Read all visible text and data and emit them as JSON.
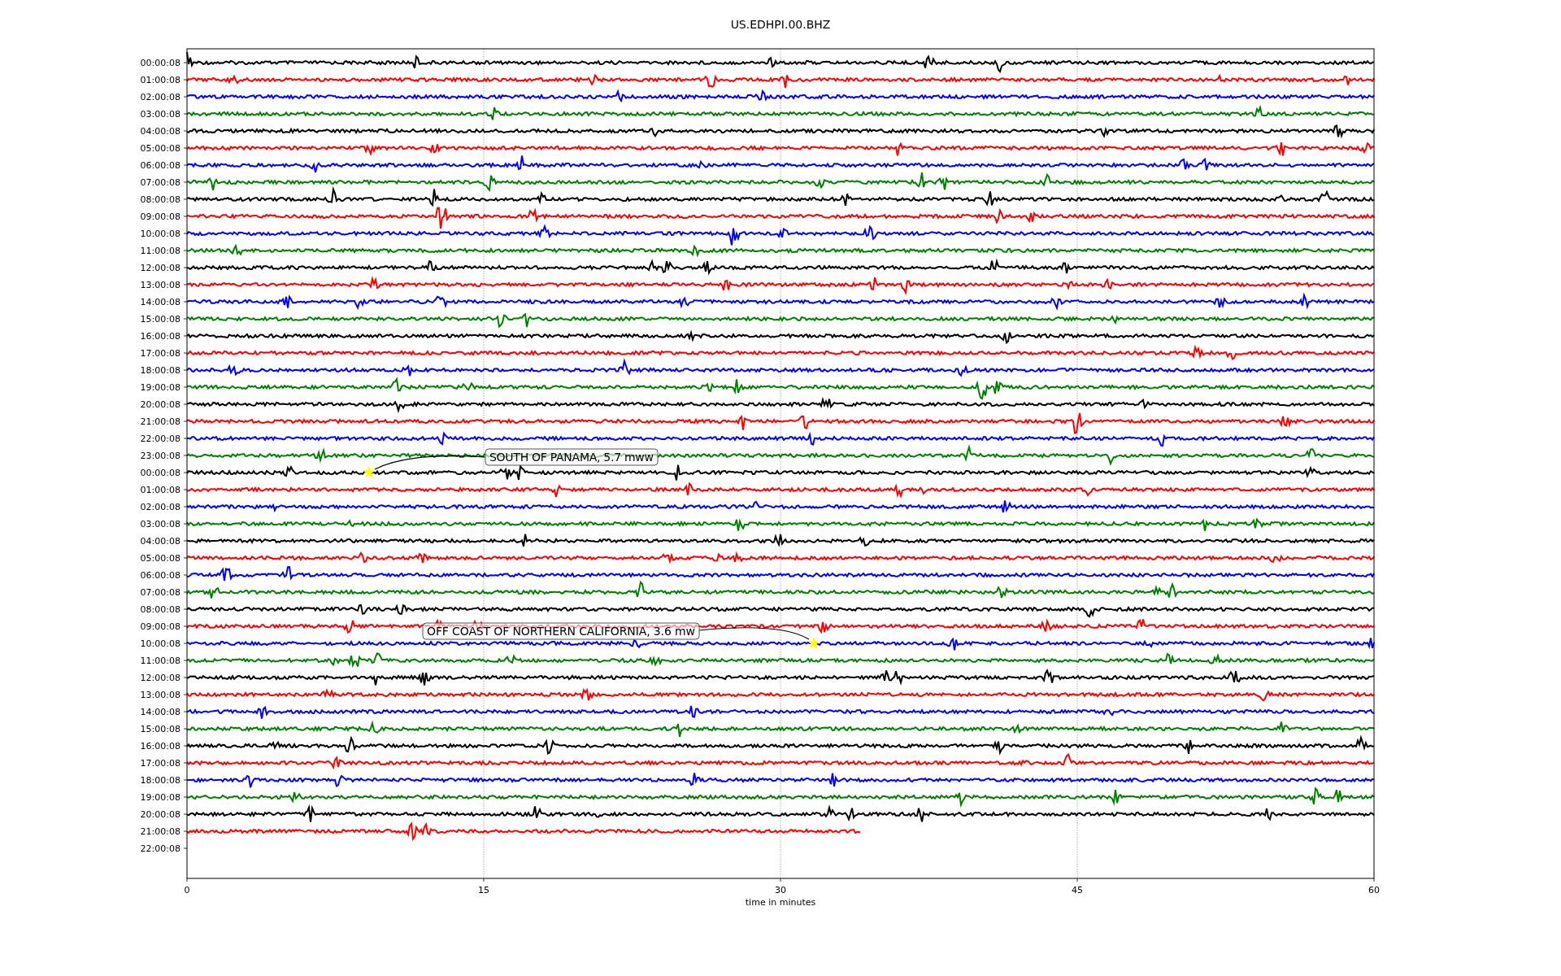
{
  "title": "US.EDHPI.00.BHZ",
  "rows": [
    {
      "label": "00:00:08",
      "color": "#000000",
      "kind": "full"
    },
    {
      "label": "01:00:08",
      "color": "#ff0000",
      "kind": "full"
    },
    {
      "label": "02:00:08",
      "color": "#0000ff",
      "kind": "full"
    },
    {
      "label": "03:00:08",
      "color": "#008000",
      "kind": "full"
    },
    {
      "label": "04:00:08",
      "color": "#000000",
      "kind": "full"
    },
    {
      "label": "05:00:08",
      "color": "#ff0000",
      "kind": "full"
    },
    {
      "label": "06:00:08",
      "color": "#0000ff",
      "kind": "full"
    },
    {
      "label": "07:00:08",
      "color": "#008000",
      "kind": "full"
    },
    {
      "label": "08:00:08",
      "color": "#000000",
      "kind": "full"
    },
    {
      "label": "09:00:08",
      "color": "#ff0000",
      "kind": "full"
    },
    {
      "label": "10:00:08",
      "color": "#0000ff",
      "kind": "full"
    },
    {
      "label": "11:00:08",
      "color": "#008000",
      "kind": "full"
    },
    {
      "label": "12:00:08",
      "color": "#000000",
      "kind": "full"
    },
    {
      "label": "13:00:08",
      "color": "#ff0000",
      "kind": "full"
    },
    {
      "label": "14:00:08",
      "color": "#0000ff",
      "kind": "full"
    },
    {
      "label": "15:00:08",
      "color": "#008000",
      "kind": "full"
    },
    {
      "label": "16:00:08",
      "color": "#000000",
      "kind": "full"
    },
    {
      "label": "17:00:08",
      "color": "#ff0000",
      "kind": "full"
    },
    {
      "label": "18:00:08",
      "color": "#0000ff",
      "kind": "full"
    },
    {
      "label": "19:00:08",
      "color": "#008000",
      "kind": "full"
    },
    {
      "label": "20:00:08",
      "color": "#000000",
      "kind": "full"
    },
    {
      "label": "21:00:08",
      "color": "#ff0000",
      "kind": "full"
    },
    {
      "label": "22:00:08",
      "color": "#0000ff",
      "kind": "full"
    },
    {
      "label": "23:00:08",
      "color": "#008000",
      "kind": "full"
    },
    {
      "label": "00:00:08",
      "color": "#000000",
      "kind": "full"
    },
    {
      "label": "01:00:08",
      "color": "#ff0000",
      "kind": "full"
    },
    {
      "label": "02:00:08",
      "color": "#0000ff",
      "kind": "full"
    },
    {
      "label": "03:00:08",
      "color": "#008000",
      "kind": "full"
    },
    {
      "label": "04:00:08",
      "color": "#000000",
      "kind": "full"
    },
    {
      "label": "05:00:08",
      "color": "#ff0000",
      "kind": "full"
    },
    {
      "label": "06:00:08",
      "color": "#0000ff",
      "kind": "full"
    },
    {
      "label": "07:00:08",
      "color": "#008000",
      "kind": "full"
    },
    {
      "label": "08:00:08",
      "color": "#000000",
      "kind": "full"
    },
    {
      "label": "09:00:08",
      "color": "#ff0000",
      "kind": "full"
    },
    {
      "label": "10:00:08",
      "color": "#0000ff",
      "kind": "full"
    },
    {
      "label": "11:00:08",
      "color": "#008000",
      "kind": "full"
    },
    {
      "label": "12:00:08",
      "color": "#000000",
      "kind": "full"
    },
    {
      "label": "13:00:08",
      "color": "#ff0000",
      "kind": "full"
    },
    {
      "label": "14:00:08",
      "color": "#0000ff",
      "kind": "full"
    },
    {
      "label": "15:00:08",
      "color": "#008000",
      "kind": "full"
    },
    {
      "label": "16:00:08",
      "color": "#000000",
      "kind": "full"
    },
    {
      "label": "17:00:08",
      "color": "#ff0000",
      "kind": "full"
    },
    {
      "label": "18:00:08",
      "color": "#0000ff",
      "kind": "full"
    },
    {
      "label": "19:00:08",
      "color": "#008000",
      "kind": "full"
    },
    {
      "label": "20:00:08",
      "color": "#000000",
      "kind": "full"
    },
    {
      "label": "21:00:08",
      "color": "#ff0000",
      "kind": "partial"
    },
    {
      "label": "22:00:08",
      "kind": "empty"
    }
  ],
  "x_axis": {
    "ticks": [
      "0",
      "15",
      "30",
      "45",
      "60"
    ],
    "label": "time in minutes"
  },
  "annotations": [
    {
      "text": "SOUTH OF PANAMA, 5.7 mww"
    },
    {
      "text": "OFF COAST OF NORTHERN CALIFORNIA, 3.6 mw"
    }
  ]
}
